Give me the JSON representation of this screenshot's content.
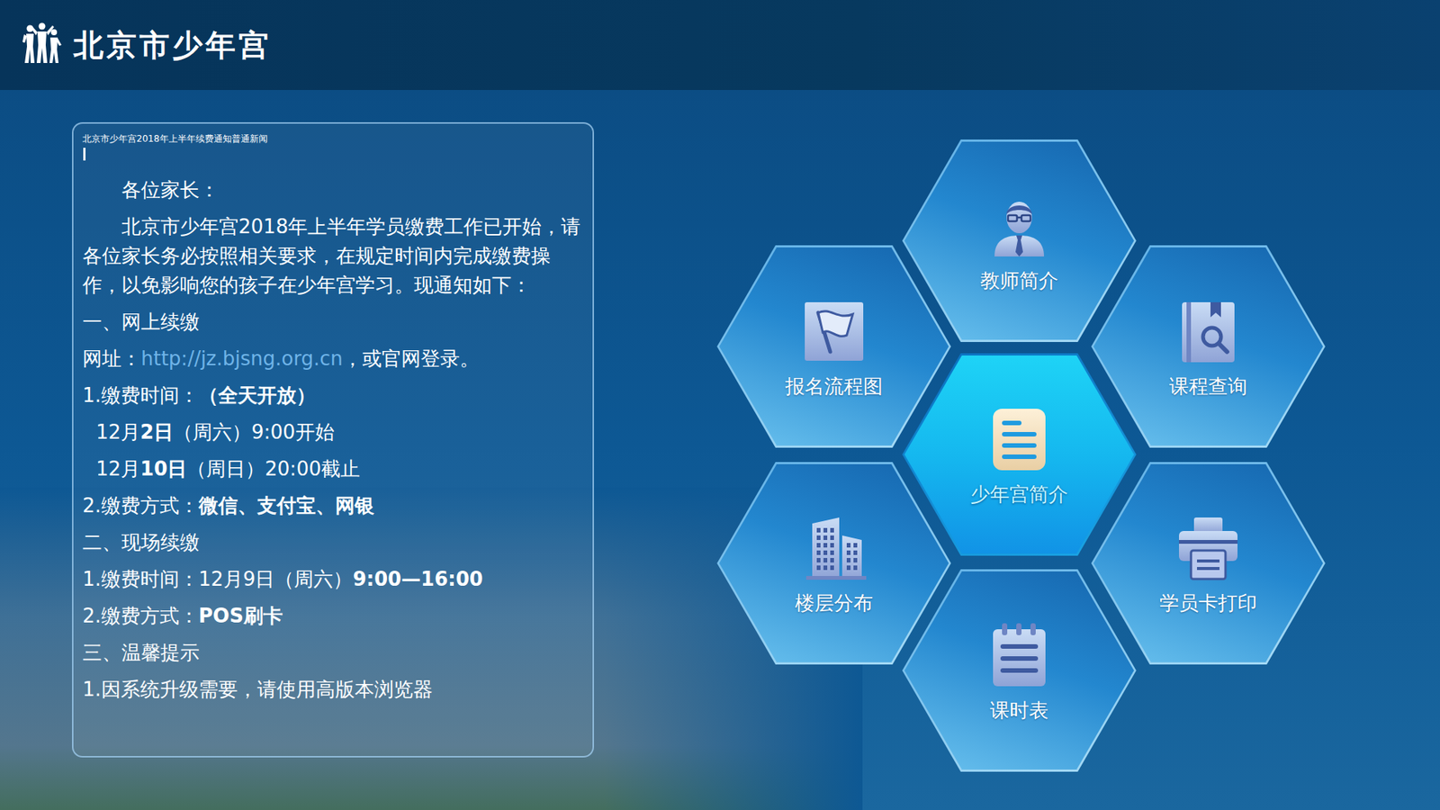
{
  "header": {
    "logo_text": "北京市少年宫"
  },
  "notice": {
    "title": "北京市少年宫2018年上半年续费通知普通新闻",
    "paragraphs": [
      {
        "kind": "indent",
        "segments": [
          {
            "kind": "text",
            "text": "各位家长："
          }
        ]
      },
      {
        "kind": "indent",
        "segments": [
          {
            "kind": "text",
            "text": "北京市少年宫2018年上半年学员缴费工作已开始，请各位家长务必按照相关要求，在规定时间内完成缴费操作，以免影响您的孩子在少年宫学习。现通知如下："
          }
        ]
      },
      {
        "kind": "plain",
        "segments": [
          {
            "kind": "text",
            "text": "一、网上续缴"
          }
        ]
      },
      {
        "kind": "plain",
        "segments": [
          {
            "kind": "text",
            "text": "网址："
          },
          {
            "kind": "link",
            "text": "http://jz.bjsng.org.cn"
          },
          {
            "kind": "text",
            "text": "，或官网登录。"
          }
        ]
      },
      {
        "kind": "plain",
        "segments": [
          {
            "kind": "text",
            "text": "1.缴费时间："
          },
          {
            "kind": "bold",
            "text": "（全天开放）"
          }
        ]
      },
      {
        "kind": "sub",
        "segments": [
          {
            "kind": "text",
            "text": "12月"
          },
          {
            "kind": "bold",
            "text": "2日"
          },
          {
            "kind": "text",
            "text": "（周六）9:00开始"
          }
        ]
      },
      {
        "kind": "sub",
        "segments": [
          {
            "kind": "text",
            "text": "12月"
          },
          {
            "kind": "bold",
            "text": "10日"
          },
          {
            "kind": "text",
            "text": "（周日）20:00截止"
          }
        ]
      },
      {
        "kind": "plain",
        "segments": [
          {
            "kind": "text",
            "text": "2.缴费方式："
          },
          {
            "kind": "bold",
            "text": "微信、支付宝、网银"
          }
        ]
      },
      {
        "kind": "plain",
        "segments": [
          {
            "kind": "text",
            "text": "二、现场续缴"
          }
        ]
      },
      {
        "kind": "plain",
        "segments": [
          {
            "kind": "text",
            "text": "1.缴费时间：12月9日（周六）"
          },
          {
            "kind": "bold",
            "text": "9:00—16:00"
          }
        ]
      },
      {
        "kind": "plain",
        "segments": [
          {
            "kind": "text",
            "text": "2.缴费方式："
          },
          {
            "kind": "bold",
            "text": "POS刷卡"
          }
        ]
      },
      {
        "kind": "plain",
        "segments": [
          {
            "kind": "text",
            "text": "三、温馨提示"
          }
        ]
      },
      {
        "kind": "plain",
        "segments": [
          {
            "kind": "text",
            "text": "1.因系统升级需要，请使用高版本浏览器"
          }
        ]
      }
    ]
  },
  "menu": [
    {
      "label": "教师简介",
      "selected": false
    },
    {
      "label": "报名流程图",
      "selected": false
    },
    {
      "label": "课程查询",
      "selected": false
    },
    {
      "label": "少年宫简介",
      "selected": true
    },
    {
      "label": "楼层分布",
      "selected": false
    },
    {
      "label": "学员卡打印",
      "selected": false
    },
    {
      "label": "课时表",
      "selected": false
    }
  ]
}
